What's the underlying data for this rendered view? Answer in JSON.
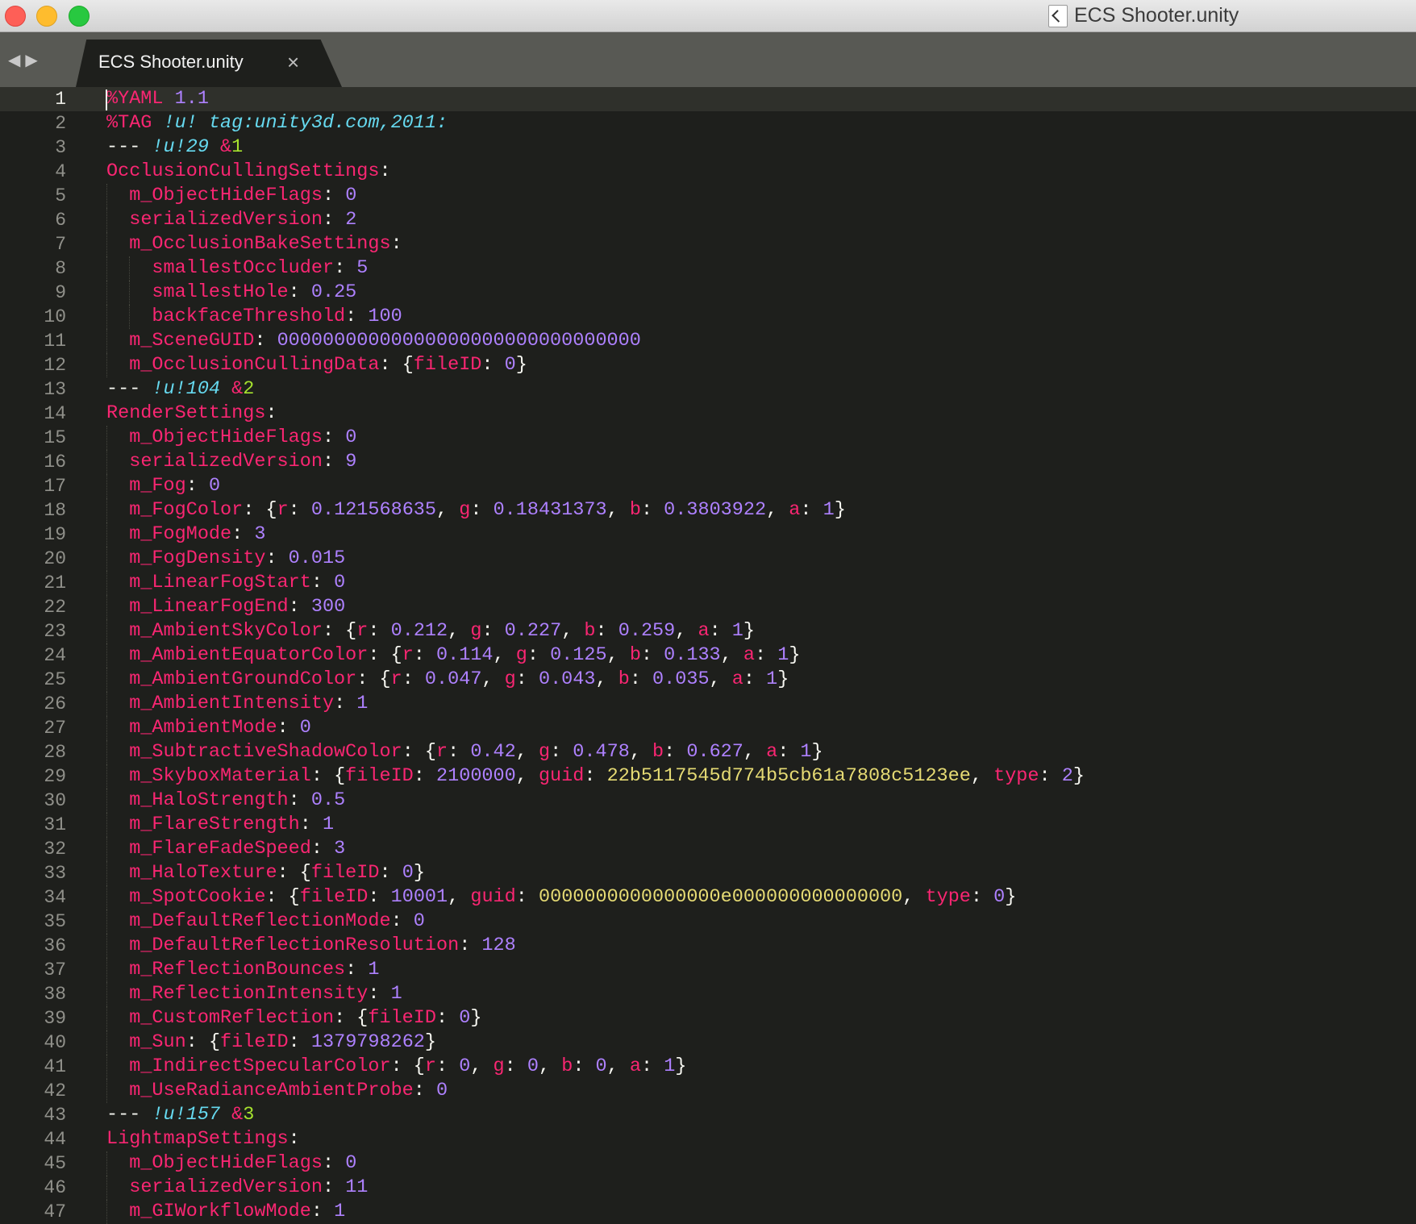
{
  "window": {
    "title": "ECS Shooter.unity"
  },
  "tab": {
    "label": "ECS Shooter.unity",
    "close_glyph": "×"
  },
  "icons": {
    "back": "back-arrow-icon",
    "forward": "forward-arrow-icon",
    "close": "close-icon",
    "document": "unity-document-icon"
  },
  "colors": {
    "key": "#f92672",
    "number": "#ae81ff",
    "string": "#e6db74",
    "tag": "#66d9ef",
    "anchor": "#a6e22e",
    "plain": "#f8f8f2",
    "background": "#1e1f1c"
  },
  "editor": {
    "current_line": 1,
    "lines": [
      [
        [
          "k",
          "%YAML"
        ],
        [
          "p",
          " "
        ],
        [
          "n",
          "1.1"
        ]
      ],
      [
        [
          "k",
          "%TAG"
        ],
        [
          "p",
          " "
        ],
        [
          "t",
          "!u! tag:unity3d.com,2011:"
        ]
      ],
      [
        [
          "p",
          "--- "
        ],
        [
          "t",
          "!u!29"
        ],
        [
          "p",
          " "
        ],
        [
          "k",
          "&"
        ],
        [
          "a",
          "1"
        ]
      ],
      [
        [
          "k",
          "OcclusionCullingSettings"
        ],
        [
          "p",
          ":"
        ]
      ],
      [
        [
          "p",
          "  "
        ],
        [
          "k",
          "m_ObjectHideFlags"
        ],
        [
          "p",
          ": "
        ],
        [
          "n",
          "0"
        ]
      ],
      [
        [
          "p",
          "  "
        ],
        [
          "k",
          "serializedVersion"
        ],
        [
          "p",
          ": "
        ],
        [
          "n",
          "2"
        ]
      ],
      [
        [
          "p",
          "  "
        ],
        [
          "k",
          "m_OcclusionBakeSettings"
        ],
        [
          "p",
          ":"
        ]
      ],
      [
        [
          "p",
          "    "
        ],
        [
          "k",
          "smallestOccluder"
        ],
        [
          "p",
          ": "
        ],
        [
          "n",
          "5"
        ]
      ],
      [
        [
          "p",
          "    "
        ],
        [
          "k",
          "smallestHole"
        ],
        [
          "p",
          ": "
        ],
        [
          "n",
          "0.25"
        ]
      ],
      [
        [
          "p",
          "    "
        ],
        [
          "k",
          "backfaceThreshold"
        ],
        [
          "p",
          ": "
        ],
        [
          "n",
          "100"
        ]
      ],
      [
        [
          "p",
          "  "
        ],
        [
          "k",
          "m_SceneGUID"
        ],
        [
          "p",
          ": "
        ],
        [
          "n",
          "00000000000000000000000000000000"
        ]
      ],
      [
        [
          "p",
          "  "
        ],
        [
          "k",
          "m_OcclusionCullingData"
        ],
        [
          "p",
          ": {"
        ],
        [
          "k",
          "fileID"
        ],
        [
          "p",
          ": "
        ],
        [
          "n",
          "0"
        ],
        [
          "p",
          "}"
        ]
      ],
      [
        [
          "p",
          "--- "
        ],
        [
          "t",
          "!u!104"
        ],
        [
          "p",
          " "
        ],
        [
          "k",
          "&"
        ],
        [
          "a",
          "2"
        ]
      ],
      [
        [
          "k",
          "RenderSettings"
        ],
        [
          "p",
          ":"
        ]
      ],
      [
        [
          "p",
          "  "
        ],
        [
          "k",
          "m_ObjectHideFlags"
        ],
        [
          "p",
          ": "
        ],
        [
          "n",
          "0"
        ]
      ],
      [
        [
          "p",
          "  "
        ],
        [
          "k",
          "serializedVersion"
        ],
        [
          "p",
          ": "
        ],
        [
          "n",
          "9"
        ]
      ],
      [
        [
          "p",
          "  "
        ],
        [
          "k",
          "m_Fog"
        ],
        [
          "p",
          ": "
        ],
        [
          "n",
          "0"
        ]
      ],
      [
        [
          "p",
          "  "
        ],
        [
          "k",
          "m_FogColor"
        ],
        [
          "p",
          ": {"
        ],
        [
          "k",
          "r"
        ],
        [
          "p",
          ": "
        ],
        [
          "n",
          "0.121568635"
        ],
        [
          "p",
          ", "
        ],
        [
          "k",
          "g"
        ],
        [
          "p",
          ": "
        ],
        [
          "n",
          "0.18431373"
        ],
        [
          "p",
          ", "
        ],
        [
          "k",
          "b"
        ],
        [
          "p",
          ": "
        ],
        [
          "n",
          "0.3803922"
        ],
        [
          "p",
          ", "
        ],
        [
          "k",
          "a"
        ],
        [
          "p",
          ": "
        ],
        [
          "n",
          "1"
        ],
        [
          "p",
          "}"
        ]
      ],
      [
        [
          "p",
          "  "
        ],
        [
          "k",
          "m_FogMode"
        ],
        [
          "p",
          ": "
        ],
        [
          "n",
          "3"
        ]
      ],
      [
        [
          "p",
          "  "
        ],
        [
          "k",
          "m_FogDensity"
        ],
        [
          "p",
          ": "
        ],
        [
          "n",
          "0.015"
        ]
      ],
      [
        [
          "p",
          "  "
        ],
        [
          "k",
          "m_LinearFogStart"
        ],
        [
          "p",
          ": "
        ],
        [
          "n",
          "0"
        ]
      ],
      [
        [
          "p",
          "  "
        ],
        [
          "k",
          "m_LinearFogEnd"
        ],
        [
          "p",
          ": "
        ],
        [
          "n",
          "300"
        ]
      ],
      [
        [
          "p",
          "  "
        ],
        [
          "k",
          "m_AmbientSkyColor"
        ],
        [
          "p",
          ": {"
        ],
        [
          "k",
          "r"
        ],
        [
          "p",
          ": "
        ],
        [
          "n",
          "0.212"
        ],
        [
          "p",
          ", "
        ],
        [
          "k",
          "g"
        ],
        [
          "p",
          ": "
        ],
        [
          "n",
          "0.227"
        ],
        [
          "p",
          ", "
        ],
        [
          "k",
          "b"
        ],
        [
          "p",
          ": "
        ],
        [
          "n",
          "0.259"
        ],
        [
          "p",
          ", "
        ],
        [
          "k",
          "a"
        ],
        [
          "p",
          ": "
        ],
        [
          "n",
          "1"
        ],
        [
          "p",
          "}"
        ]
      ],
      [
        [
          "p",
          "  "
        ],
        [
          "k",
          "m_AmbientEquatorColor"
        ],
        [
          "p",
          ": {"
        ],
        [
          "k",
          "r"
        ],
        [
          "p",
          ": "
        ],
        [
          "n",
          "0.114"
        ],
        [
          "p",
          ", "
        ],
        [
          "k",
          "g"
        ],
        [
          "p",
          ": "
        ],
        [
          "n",
          "0.125"
        ],
        [
          "p",
          ", "
        ],
        [
          "k",
          "b"
        ],
        [
          "p",
          ": "
        ],
        [
          "n",
          "0.133"
        ],
        [
          "p",
          ", "
        ],
        [
          "k",
          "a"
        ],
        [
          "p",
          ": "
        ],
        [
          "n",
          "1"
        ],
        [
          "p",
          "}"
        ]
      ],
      [
        [
          "p",
          "  "
        ],
        [
          "k",
          "m_AmbientGroundColor"
        ],
        [
          "p",
          ": {"
        ],
        [
          "k",
          "r"
        ],
        [
          "p",
          ": "
        ],
        [
          "n",
          "0.047"
        ],
        [
          "p",
          ", "
        ],
        [
          "k",
          "g"
        ],
        [
          "p",
          ": "
        ],
        [
          "n",
          "0.043"
        ],
        [
          "p",
          ", "
        ],
        [
          "k",
          "b"
        ],
        [
          "p",
          ": "
        ],
        [
          "n",
          "0.035"
        ],
        [
          "p",
          ", "
        ],
        [
          "k",
          "a"
        ],
        [
          "p",
          ": "
        ],
        [
          "n",
          "1"
        ],
        [
          "p",
          "}"
        ]
      ],
      [
        [
          "p",
          "  "
        ],
        [
          "k",
          "m_AmbientIntensity"
        ],
        [
          "p",
          ": "
        ],
        [
          "n",
          "1"
        ]
      ],
      [
        [
          "p",
          "  "
        ],
        [
          "k",
          "m_AmbientMode"
        ],
        [
          "p",
          ": "
        ],
        [
          "n",
          "0"
        ]
      ],
      [
        [
          "p",
          "  "
        ],
        [
          "k",
          "m_SubtractiveShadowColor"
        ],
        [
          "p",
          ": {"
        ],
        [
          "k",
          "r"
        ],
        [
          "p",
          ": "
        ],
        [
          "n",
          "0.42"
        ],
        [
          "p",
          ", "
        ],
        [
          "k",
          "g"
        ],
        [
          "p",
          ": "
        ],
        [
          "n",
          "0.478"
        ],
        [
          "p",
          ", "
        ],
        [
          "k",
          "b"
        ],
        [
          "p",
          ": "
        ],
        [
          "n",
          "0.627"
        ],
        [
          "p",
          ", "
        ],
        [
          "k",
          "a"
        ],
        [
          "p",
          ": "
        ],
        [
          "n",
          "1"
        ],
        [
          "p",
          "}"
        ]
      ],
      [
        [
          "p",
          "  "
        ],
        [
          "k",
          "m_SkyboxMaterial"
        ],
        [
          "p",
          ": {"
        ],
        [
          "k",
          "fileID"
        ],
        [
          "p",
          ": "
        ],
        [
          "n",
          "2100000"
        ],
        [
          "p",
          ", "
        ],
        [
          "k",
          "guid"
        ],
        [
          "p",
          ": "
        ],
        [
          "s",
          "22b5117545d774b5cb61a7808c5123ee"
        ],
        [
          "p",
          ", "
        ],
        [
          "k",
          "type"
        ],
        [
          "p",
          ": "
        ],
        [
          "n",
          "2"
        ],
        [
          "p",
          "}"
        ]
      ],
      [
        [
          "p",
          "  "
        ],
        [
          "k",
          "m_HaloStrength"
        ],
        [
          "p",
          ": "
        ],
        [
          "n",
          "0.5"
        ]
      ],
      [
        [
          "p",
          "  "
        ],
        [
          "k",
          "m_FlareStrength"
        ],
        [
          "p",
          ": "
        ],
        [
          "n",
          "1"
        ]
      ],
      [
        [
          "p",
          "  "
        ],
        [
          "k",
          "m_FlareFadeSpeed"
        ],
        [
          "p",
          ": "
        ],
        [
          "n",
          "3"
        ]
      ],
      [
        [
          "p",
          "  "
        ],
        [
          "k",
          "m_HaloTexture"
        ],
        [
          "p",
          ": {"
        ],
        [
          "k",
          "fileID"
        ],
        [
          "p",
          ": "
        ],
        [
          "n",
          "0"
        ],
        [
          "p",
          "}"
        ]
      ],
      [
        [
          "p",
          "  "
        ],
        [
          "k",
          "m_SpotCookie"
        ],
        [
          "p",
          ": {"
        ],
        [
          "k",
          "fileID"
        ],
        [
          "p",
          ": "
        ],
        [
          "n",
          "10001"
        ],
        [
          "p",
          ", "
        ],
        [
          "k",
          "guid"
        ],
        [
          "p",
          ": "
        ],
        [
          "s",
          "0000000000000000e000000000000000"
        ],
        [
          "p",
          ", "
        ],
        [
          "k",
          "type"
        ],
        [
          "p",
          ": "
        ],
        [
          "n",
          "0"
        ],
        [
          "p",
          "}"
        ]
      ],
      [
        [
          "p",
          "  "
        ],
        [
          "k",
          "m_DefaultReflectionMode"
        ],
        [
          "p",
          ": "
        ],
        [
          "n",
          "0"
        ]
      ],
      [
        [
          "p",
          "  "
        ],
        [
          "k",
          "m_DefaultReflectionResolution"
        ],
        [
          "p",
          ": "
        ],
        [
          "n",
          "128"
        ]
      ],
      [
        [
          "p",
          "  "
        ],
        [
          "k",
          "m_ReflectionBounces"
        ],
        [
          "p",
          ": "
        ],
        [
          "n",
          "1"
        ]
      ],
      [
        [
          "p",
          "  "
        ],
        [
          "k",
          "m_ReflectionIntensity"
        ],
        [
          "p",
          ": "
        ],
        [
          "n",
          "1"
        ]
      ],
      [
        [
          "p",
          "  "
        ],
        [
          "k",
          "m_CustomReflection"
        ],
        [
          "p",
          ": {"
        ],
        [
          "k",
          "fileID"
        ],
        [
          "p",
          ": "
        ],
        [
          "n",
          "0"
        ],
        [
          "p",
          "}"
        ]
      ],
      [
        [
          "p",
          "  "
        ],
        [
          "k",
          "m_Sun"
        ],
        [
          "p",
          ": {"
        ],
        [
          "k",
          "fileID"
        ],
        [
          "p",
          ": "
        ],
        [
          "n",
          "1379798262"
        ],
        [
          "p",
          "}"
        ]
      ],
      [
        [
          "p",
          "  "
        ],
        [
          "k",
          "m_IndirectSpecularColor"
        ],
        [
          "p",
          ": {"
        ],
        [
          "k",
          "r"
        ],
        [
          "p",
          ": "
        ],
        [
          "n",
          "0"
        ],
        [
          "p",
          ", "
        ],
        [
          "k",
          "g"
        ],
        [
          "p",
          ": "
        ],
        [
          "n",
          "0"
        ],
        [
          "p",
          ", "
        ],
        [
          "k",
          "b"
        ],
        [
          "p",
          ": "
        ],
        [
          "n",
          "0"
        ],
        [
          "p",
          ", "
        ],
        [
          "k",
          "a"
        ],
        [
          "p",
          ": "
        ],
        [
          "n",
          "1"
        ],
        [
          "p",
          "}"
        ]
      ],
      [
        [
          "p",
          "  "
        ],
        [
          "k",
          "m_UseRadianceAmbientProbe"
        ],
        [
          "p",
          ": "
        ],
        [
          "n",
          "0"
        ]
      ],
      [
        [
          "p",
          "--- "
        ],
        [
          "t",
          "!u!157"
        ],
        [
          "p",
          " "
        ],
        [
          "k",
          "&"
        ],
        [
          "a",
          "3"
        ]
      ],
      [
        [
          "k",
          "LightmapSettings"
        ],
        [
          "p",
          ":"
        ]
      ],
      [
        [
          "p",
          "  "
        ],
        [
          "k",
          "m_ObjectHideFlags"
        ],
        [
          "p",
          ": "
        ],
        [
          "n",
          "0"
        ]
      ],
      [
        [
          "p",
          "  "
        ],
        [
          "k",
          "serializedVersion"
        ],
        [
          "p",
          ": "
        ],
        [
          "n",
          "11"
        ]
      ],
      [
        [
          "p",
          "  "
        ],
        [
          "k",
          "m_GIWorkflowMode"
        ],
        [
          "p",
          ": "
        ],
        [
          "n",
          "1"
        ]
      ]
    ]
  }
}
